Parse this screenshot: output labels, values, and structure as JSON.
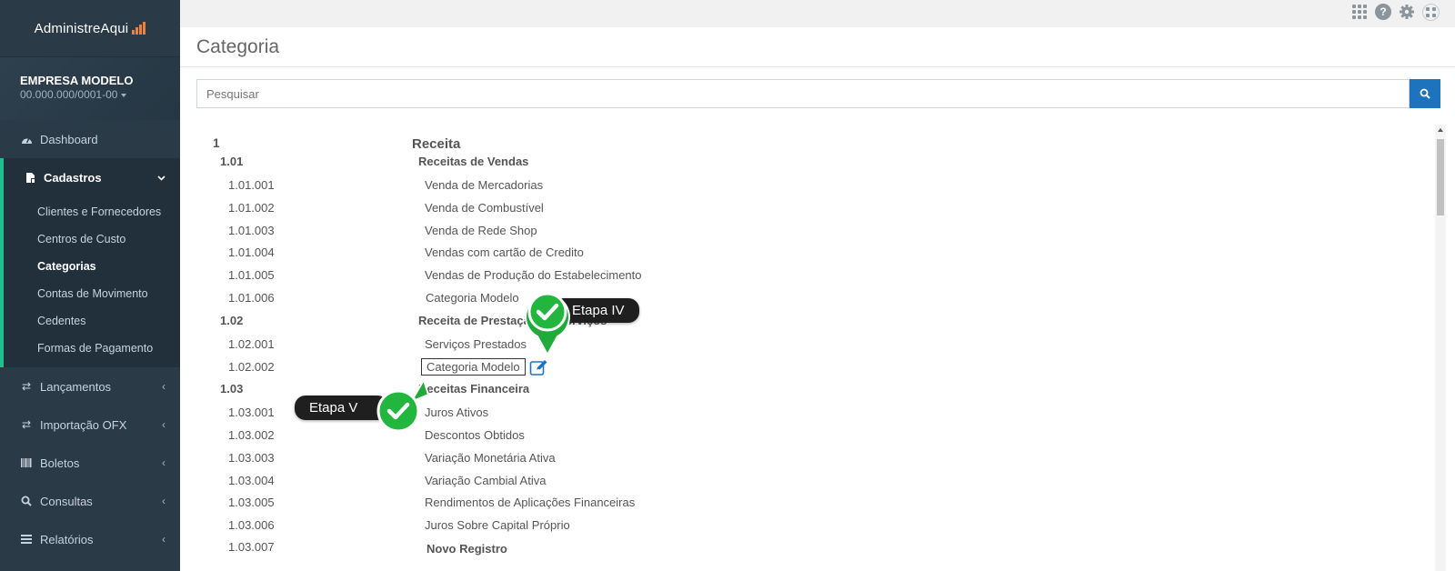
{
  "brand": {
    "name": "AdministreAqui"
  },
  "company": {
    "name": "EMPRESA MODELO",
    "cnpj": "00.000.000/0001-00"
  },
  "nav": {
    "dashboard": "Dashboard",
    "cadastros": "Cadastros",
    "cadastros_items": [
      "Clientes e Fornecedores",
      "Centros de Custo",
      "Categorias",
      "Contas de Movimento",
      "Cedentes",
      "Formas de Pagamento"
    ],
    "lancamentos": "Lançamentos",
    "importacao": "Importação OFX",
    "boletos": "Boletos",
    "consultas": "Consultas",
    "relatorios": "Relatórios"
  },
  "topbar": {
    "help_icon": "question-icon",
    "settings_icon": "gear-icon"
  },
  "page": {
    "title": "Categoria"
  },
  "search": {
    "placeholder": "Pesquisar"
  },
  "tree": [
    {
      "code": "1",
      "label": "Receita"
    },
    {
      "code": "1.01",
      "label": "Receitas de Vendas"
    },
    {
      "code": "1.01.001",
      "label": "Venda de Mercadorias"
    },
    {
      "code": "1.01.002",
      "label": "Venda de Combustível"
    },
    {
      "code": "1.01.003",
      "label": "Venda de Rede Shop"
    },
    {
      "code": "1.01.004",
      "label": "Vendas com cartão de Credito"
    },
    {
      "code": "1.01.005",
      "label": "Vendas de Produção do Estabelecimento"
    },
    {
      "code": "1.01.006",
      "label": "Categoria Modelo"
    },
    {
      "code": "1.02",
      "label": "Receita de Prestação de Serviços"
    },
    {
      "code": "1.02.001",
      "label": "Serviços Prestados"
    },
    {
      "code": "1.02.002",
      "label": "Categoria Modelo"
    },
    {
      "code": "1.03",
      "label": "Receitas Financeira"
    },
    {
      "code": "1.03.001",
      "label": "Juros Ativos"
    },
    {
      "code": "1.03.002",
      "label": "Descontos Obtidos"
    },
    {
      "code": "1.03.003",
      "label": "Variação Monetária Ativa"
    },
    {
      "code": "1.03.004",
      "label": "Variação Cambial Ativa"
    },
    {
      "code": "1.03.005",
      "label": "Rendimentos de Aplicações Financeiras"
    },
    {
      "code": "1.03.006",
      "label": "Juros Sobre Capital Próprio"
    },
    {
      "code": "1.03.007",
      "label": "Novo Registro"
    }
  ],
  "tour": {
    "step4": "Etapa IV",
    "step5": "Etapa V"
  }
}
